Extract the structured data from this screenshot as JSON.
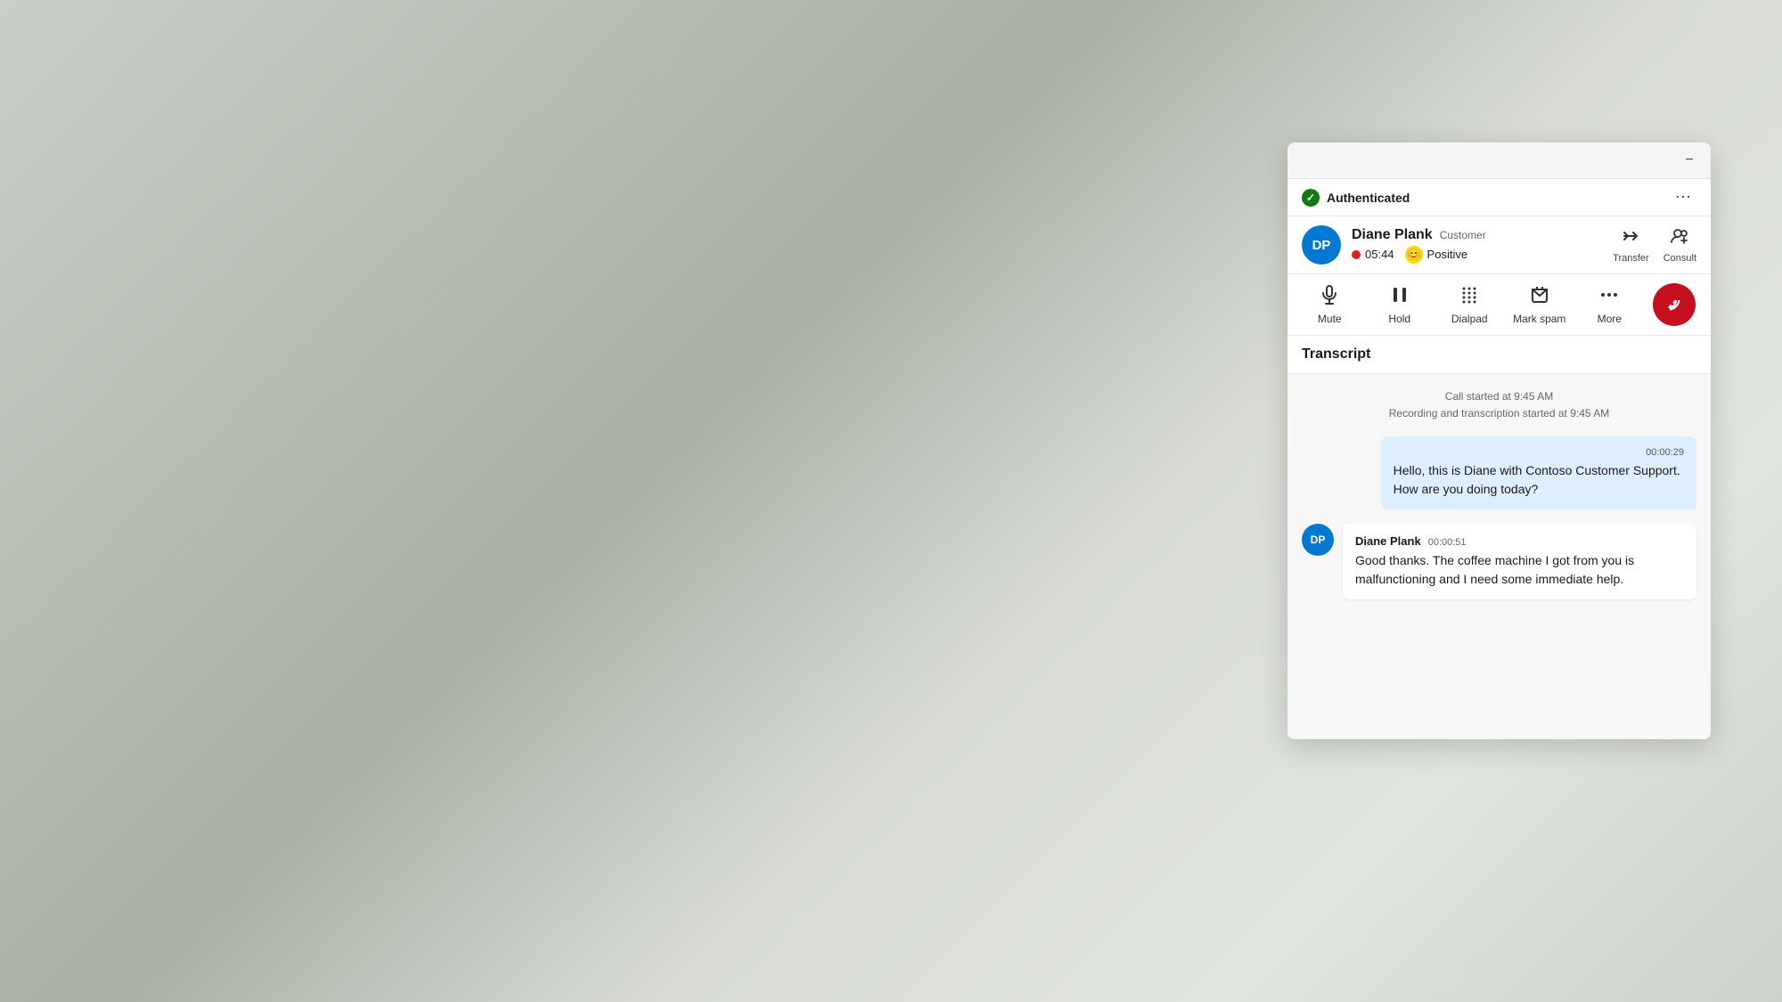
{
  "background": {
    "color_start": "#c8cfc8",
    "color_end": "#cdd1cb"
  },
  "panel": {
    "topbar": {
      "minimize_label": "−"
    },
    "auth_bar": {
      "status": "Authenticated",
      "more_icon": "⋯"
    },
    "contact": {
      "initials": "DP",
      "name": "Diane Plank",
      "role": "Customer",
      "call_duration": "05:44",
      "sentiment": "Positive",
      "transfer_label": "Transfer",
      "consult_label": "Consult"
    },
    "toolbar": {
      "mute_label": "Mute",
      "hold_label": "Hold",
      "dialpad_label": "Dialpad",
      "markspam_label": "Mark spam",
      "more_label": "More"
    },
    "transcript": {
      "title": "Transcript",
      "call_started": "Call started at 9:45 AM",
      "recording_started": "Recording and transcription started at 9:45 AM",
      "messages": [
        {
          "type": "right",
          "timestamp": "00:00:29",
          "text": "Hello, this is Diane with Contoso Customer Support. How are you doing today?"
        },
        {
          "type": "left",
          "sender": "Diane Plank",
          "sender_time": "00:00:51",
          "initials": "DP",
          "text": "Good thanks. The coffee machine I got from you is malfunctioning and I need some immediate help."
        }
      ]
    }
  }
}
